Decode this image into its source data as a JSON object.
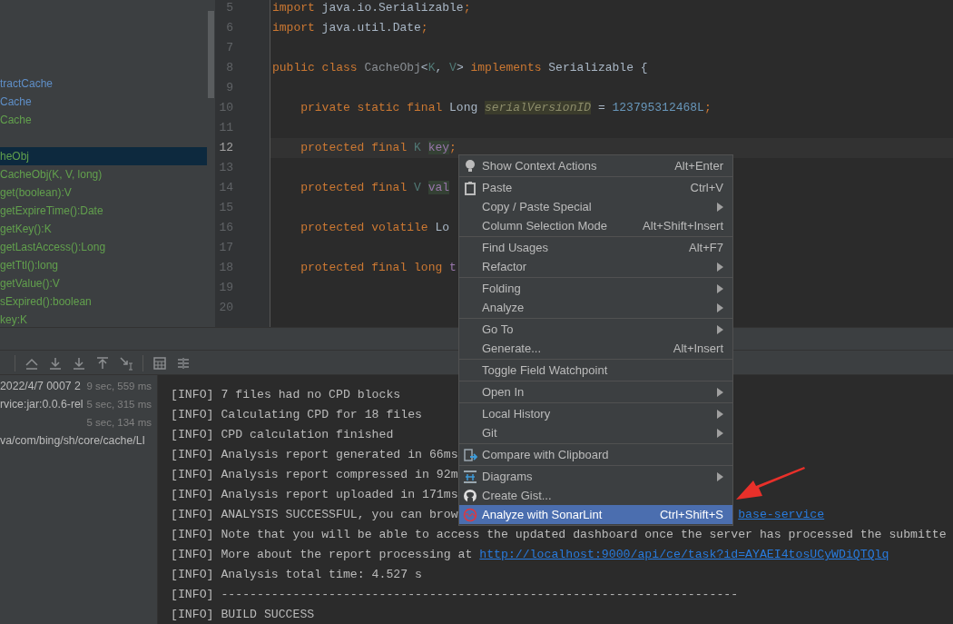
{
  "structure": {
    "groups": [
      {
        "items": [
          {
            "label": "tractCache",
            "color": "#5f8fc8",
            "selected": false
          },
          {
            "label": "Cache",
            "color": "#5f8fc8",
            "selected": false
          },
          {
            "label": "Cache",
            "color": "#62a04d",
            "selected": false
          }
        ]
      },
      {
        "items": [
          {
            "label": "heObj",
            "color": "#62a04d",
            "selected": true
          },
          {
            "label": "CacheObj(K, V, long)",
            "color": "#62a04d",
            "selected": false
          },
          {
            "label": "get(boolean):V",
            "color": "#62a04d",
            "selected": false
          },
          {
            "label": "getExpireTime():Date",
            "color": "#62a04d",
            "selected": false
          },
          {
            "label": "getKey():K",
            "color": "#62a04d",
            "selected": false
          },
          {
            "label": "getLastAccess():Long",
            "color": "#62a04d",
            "selected": false
          },
          {
            "label": "getTtl():long",
            "color": "#62a04d",
            "selected": false
          },
          {
            "label": "getValue():V",
            "color": "#62a04d",
            "selected": false
          },
          {
            "label": "sExpired():boolean",
            "color": "#62a04d",
            "selected": false
          },
          {
            "label": "key:K",
            "color": "#62a04d",
            "selected": false
          }
        ]
      }
    ]
  },
  "editor": {
    "lines": [
      {
        "number": "5",
        "current": false,
        "tokens": [
          {
            "kind": "keyword",
            "text": "import"
          },
          {
            "kind": "plain",
            "text": " java.io.Serializable"
          },
          {
            "kind": "keyword",
            "text": ";"
          }
        ]
      },
      {
        "number": "6",
        "current": false,
        "tokens": [
          {
            "kind": "keyword",
            "text": "import"
          },
          {
            "kind": "plain",
            "text": " java.util.Date"
          },
          {
            "kind": "keyword",
            "text": ";"
          }
        ]
      },
      {
        "number": "7",
        "current": false
      },
      {
        "number": "8",
        "current": false,
        "tokens": [
          {
            "kind": "keyword",
            "text": "public class "
          },
          {
            "kind": "classname",
            "text": "CacheObj"
          },
          {
            "kind": "plain",
            "text": "<"
          },
          {
            "kind": "typeparam",
            "text": "K"
          },
          {
            "kind": "plain",
            "text": ", "
          },
          {
            "kind": "typeparam",
            "text": "V"
          },
          {
            "kind": "plain",
            "text": "> "
          },
          {
            "kind": "keyword",
            "text": "implements"
          },
          {
            "kind": "plain",
            "text": " Serializable {"
          }
        ]
      },
      {
        "number": "9",
        "current": false
      },
      {
        "number": "10",
        "current": false,
        "tokens": [
          {
            "kind": "keyword",
            "text": "    private static final"
          },
          {
            "kind": "plain",
            "text": " Long "
          },
          {
            "kind": "unused-marked",
            "text": "serialVersionID"
          },
          {
            "kind": "plain",
            "text": " = "
          },
          {
            "kind": "number",
            "text": "123795312468L"
          },
          {
            "kind": "keyword",
            "text": ";"
          }
        ]
      },
      {
        "number": "11",
        "current": false
      },
      {
        "number": "12",
        "current": true,
        "tokens": [
          {
            "kind": "keyword",
            "text": "    protected final"
          },
          {
            "kind": "typeparam",
            "text": " K "
          },
          {
            "kind": "field-marked",
            "text": "key"
          },
          {
            "kind": "keyword",
            "text": ";"
          }
        ]
      },
      {
        "number": "13",
        "current": false
      },
      {
        "number": "14",
        "current": false,
        "tokens": [
          {
            "kind": "keyword",
            "text": "    protected final"
          },
          {
            "kind": "typeparam",
            "text": " V "
          },
          {
            "kind": "field-marked",
            "text": "val"
          }
        ]
      },
      {
        "number": "15",
        "current": false
      },
      {
        "number": "16",
        "current": false,
        "tokens": [
          {
            "kind": "keyword",
            "text": "    protected volatile"
          },
          {
            "kind": "plain",
            "text": " Lo"
          }
        ]
      },
      {
        "number": "17",
        "current": false
      },
      {
        "number": "18",
        "current": false,
        "tokens": [
          {
            "kind": "keyword",
            "text": "    protected final long"
          },
          {
            "kind": "field",
            "text": " t"
          }
        ]
      },
      {
        "number": "19",
        "current": false
      },
      {
        "number": "20",
        "current": false
      }
    ]
  },
  "build_tree": {
    "rows": [
      {
        "label": "2022/4/7 0007 2",
        "time": "9 sec, 559 ms"
      },
      {
        "label": "rvice:jar:0.0.6-rel",
        "time": "5 sec, 315 ms"
      },
      {
        "label": "",
        "time": "5 sec, 134 ms"
      },
      {
        "label": "va/com/bing/sh/core/cache/LI"
      }
    ]
  },
  "console": {
    "lines": [
      {
        "kind": "plain",
        "text": "[INFO] 7 files had no CPD blocks"
      },
      {
        "kind": "plain",
        "text": "[INFO] Calculating CPD for 18 files"
      },
      {
        "kind": "plain",
        "text": "[INFO] CPD calculation finished"
      },
      {
        "kind": "plain",
        "text": "[INFO] Analysis report generated in 66ms"
      },
      {
        "kind": "plain",
        "text": "[INFO] Analysis report compressed in 92m"
      },
      {
        "kind": "plain",
        "text": "[INFO] Analysis report uploaded in 171ms"
      },
      {
        "kind": "covered-link",
        "text": "[INFO] ANALYSIS SUCCESSFUL, you can brow",
        "link": "base-service"
      },
      {
        "kind": "plain",
        "text": "[INFO] Note that you will be able to access the updated dashboard once the server has processed the submitte"
      },
      {
        "kind": "link",
        "text": "[INFO] More about the report processing at ",
        "link": "http://localhost:9000/api/ce/task?id=AYAEI4tosUCyWDiQTQlq"
      },
      {
        "kind": "plain",
        "text": "[INFO] Analysis total time: 4.527 s"
      },
      {
        "kind": "plain",
        "text": "[INFO] ------------------------------------------------------------------------"
      },
      {
        "kind": "plain",
        "text": "[INFO] BUILD SUCCESS"
      }
    ]
  },
  "context_menu": {
    "items": [
      {
        "kind": "bulb",
        "label": "Show Context Actions",
        "shortcut": "Alt+Enter",
        "submenu": false,
        "selected": false
      },
      {
        "kind": "separator"
      },
      {
        "kind": "paste",
        "label": "Paste",
        "shortcut": "Ctrl+V",
        "submenu": false,
        "selected": false
      },
      {
        "kind": "plain",
        "label": "Copy / Paste Special",
        "submenu": true,
        "selected": false
      },
      {
        "kind": "plain",
        "label": "Column Selection Mode",
        "shortcut": "Alt+Shift+Insert",
        "submenu": false,
        "selected": false
      },
      {
        "kind": "separator"
      },
      {
        "kind": "plain",
        "label": "Find Usages",
        "shortcut": "Alt+F7",
        "submenu": false,
        "selected": false
      },
      {
        "kind": "plain",
        "label": "Refactor",
        "submenu": true,
        "selected": false
      },
      {
        "kind": "separator"
      },
      {
        "kind": "plain",
        "label": "Folding",
        "submenu": true,
        "selected": false
      },
      {
        "kind": "plain",
        "label": "Analyze",
        "submenu": true,
        "selected": false
      },
      {
        "kind": "separator"
      },
      {
        "kind": "plain",
        "label": "Go To",
        "submenu": true,
        "selected": false
      },
      {
        "kind": "plain",
        "label": "Generate...",
        "shortcut": "Alt+Insert",
        "submenu": false,
        "selected": false
      },
      {
        "kind": "separator"
      },
      {
        "kind": "plain",
        "label": "Toggle Field Watchpoint",
        "submenu": false,
        "selected": false
      },
      {
        "kind": "separator"
      },
      {
        "kind": "plain",
        "label": "Open In",
        "submenu": true,
        "selected": false
      },
      {
        "kind": "separator"
      },
      {
        "kind": "plain",
        "label": "Local History",
        "submenu": true,
        "selected": false
      },
      {
        "kind": "plain",
        "label": "Git",
        "submenu": true,
        "selected": false
      },
      {
        "kind": "separator"
      },
      {
        "kind": "compare",
        "label": "Compare with Clipboard",
        "submenu": false,
        "selected": false
      },
      {
        "kind": "separator"
      },
      {
        "kind": "diagram",
        "label": "Diagrams",
        "submenu": true,
        "selected": false
      },
      {
        "kind": "gist",
        "label": "Create Gist...",
        "submenu": false,
        "selected": false
      },
      {
        "kind": "sonar",
        "label": "Analyze with SonarLint",
        "shortcut": "Ctrl+Shift+S",
        "submenu": false,
        "selected": true
      }
    ]
  }
}
